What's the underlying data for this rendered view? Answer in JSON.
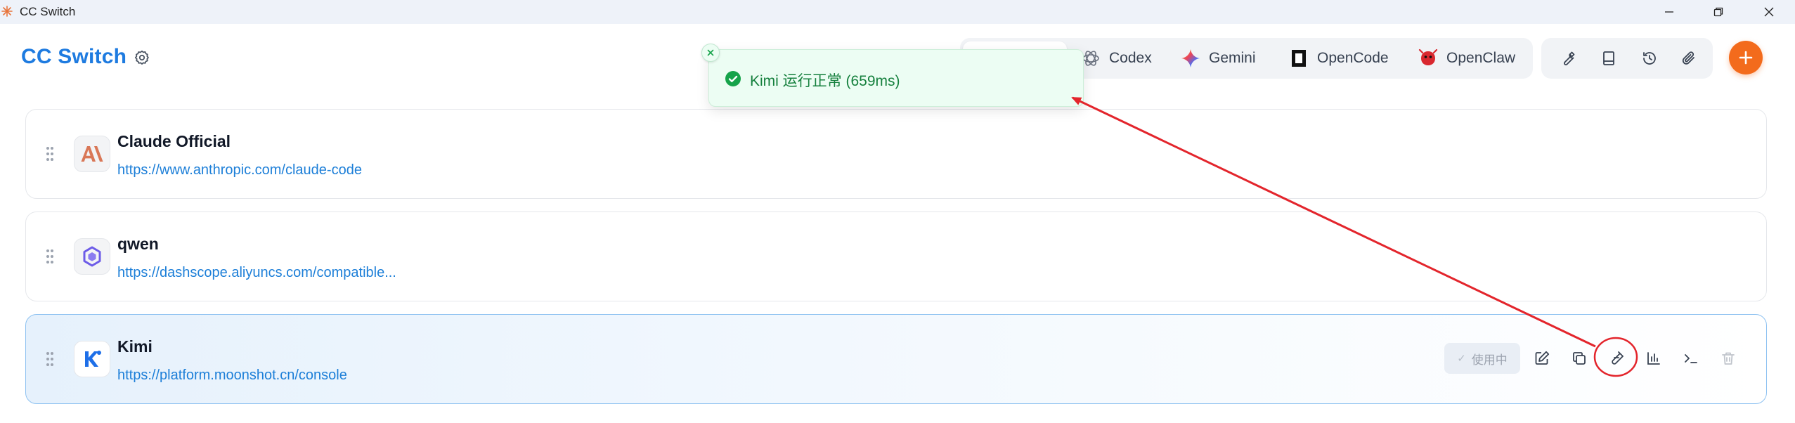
{
  "window": {
    "title": "CC Switch",
    "controls": [
      "minimize-icon",
      "restore-icon",
      "close-icon"
    ]
  },
  "header": {
    "brand": "CC Switch",
    "brand_color": "#1e7be0",
    "settings_icon": "gear-icon",
    "tabs": [
      {
        "label": "",
        "icon": "claude-icon",
        "active": true
      },
      {
        "label": "Codex",
        "icon": "openai-icon"
      },
      {
        "label": "Gemini",
        "icon": "gemini-icon"
      },
      {
        "label": "OpenCode",
        "icon": "opencode-icon"
      },
      {
        "label": "OpenClaw",
        "icon": "claw-icon"
      }
    ],
    "tools": [
      "wrench-icon",
      "book-icon",
      "history-icon",
      "attachment-icon"
    ],
    "add_icon": "plus-icon",
    "add_color": "#f36b1c"
  },
  "toast": {
    "message": "Kimi 运行正常 (659ms)",
    "status": "success",
    "close_icon": "close-icon",
    "color": "#15803d"
  },
  "providers": [
    {
      "name": "Claude Official",
      "url": "https://www.anthropic.com/claude-code",
      "logo": "anthropic-logo",
      "active": false
    },
    {
      "name": "qwen",
      "url": "https://dashscope.aliyuncs.com/compatible...",
      "logo": "qwen-logo",
      "active": false
    },
    {
      "name": "Kimi",
      "url": "https://platform.moonshot.cn/console",
      "logo": "kimi-logo",
      "active": true,
      "in_use_label": "使用中",
      "actions": [
        "edit-icon",
        "duplicate-icon",
        "test-icon",
        "usage-chart-icon",
        "terminal-icon",
        "delete-icon"
      ]
    }
  ],
  "annotation": {
    "color": "#e3252c"
  }
}
